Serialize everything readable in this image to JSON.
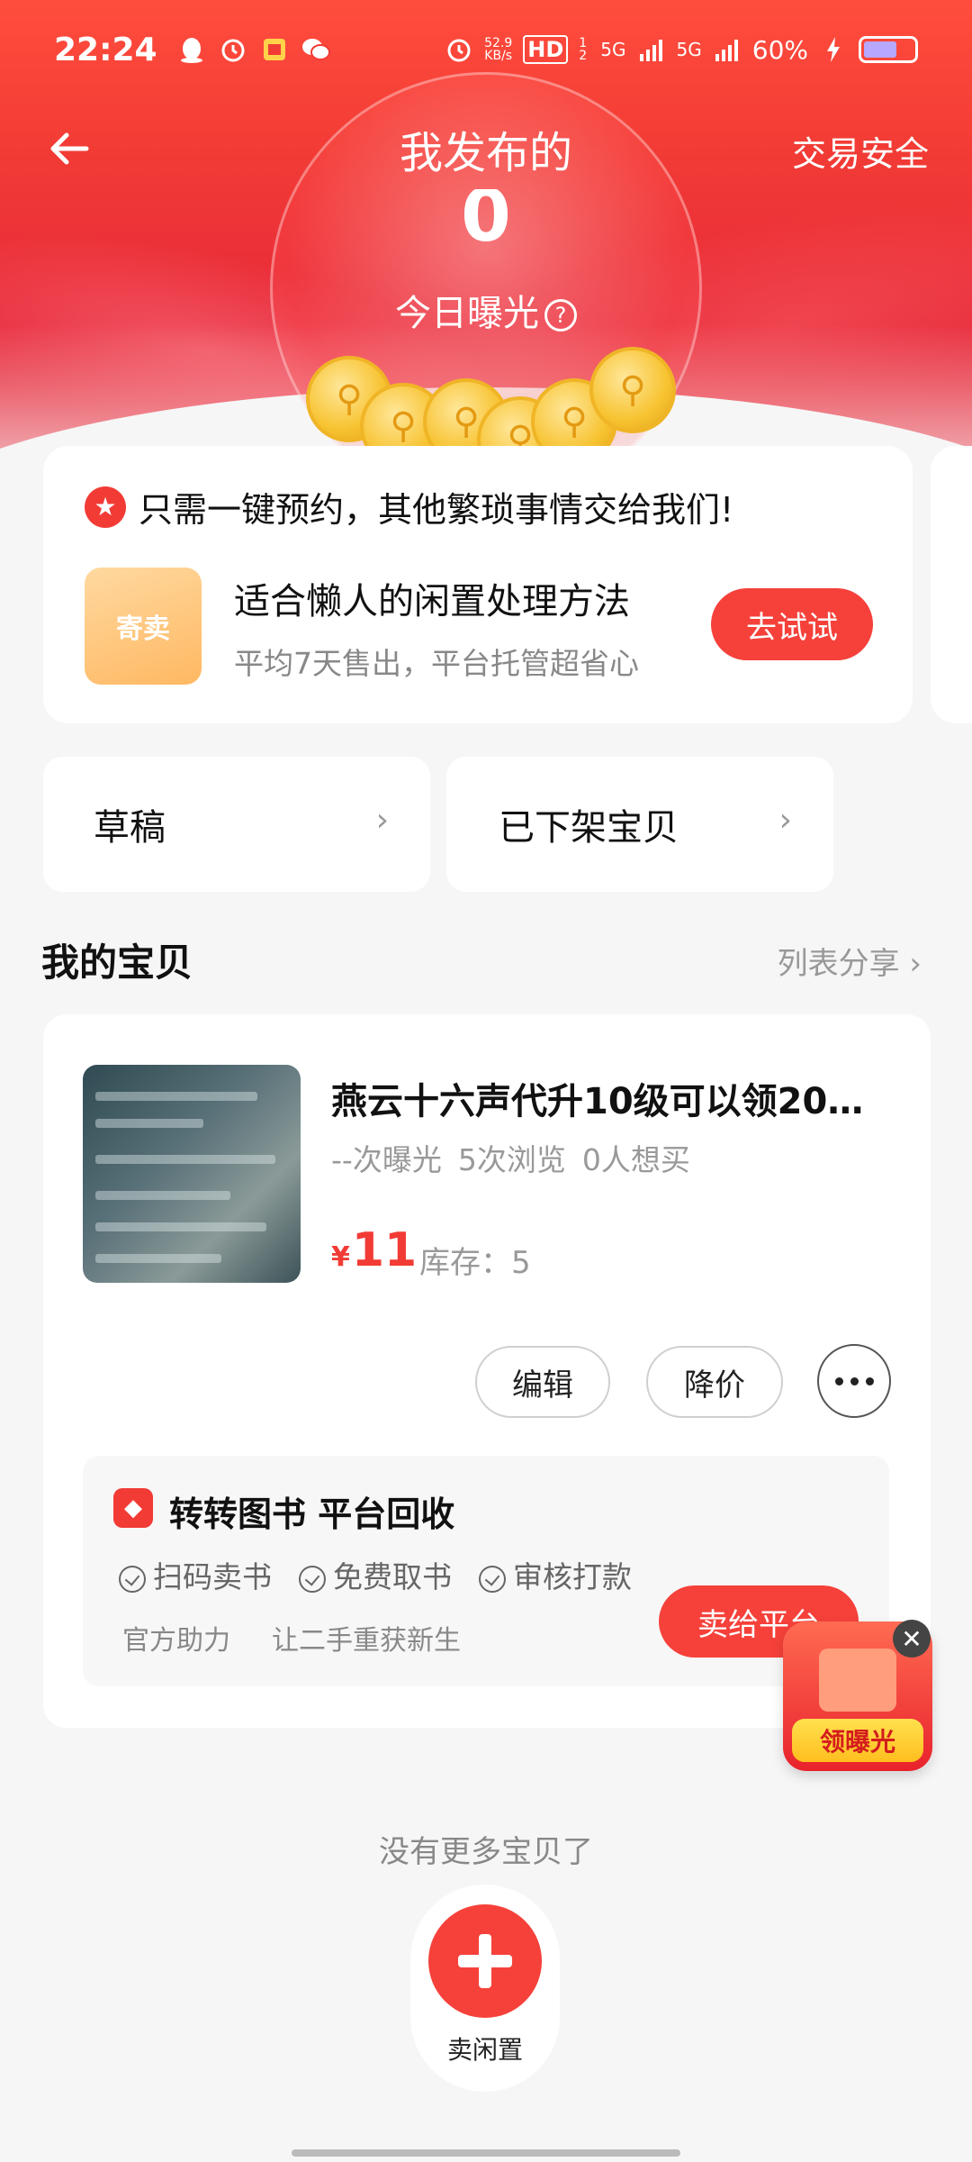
{
  "status_bar": {
    "time": "22:24",
    "net_speed": "52.9",
    "net_speed_unit": "KB/s",
    "hd": "HD",
    "hd_sub": "1 2",
    "sig1": "5G",
    "sig2": "5G",
    "battery": "60%"
  },
  "nav": {
    "title": "我发布的",
    "right_link": "交易安全"
  },
  "hero": {
    "exposure_value": "0",
    "exposure_label": "今日曝光",
    "help_icon": "?"
  },
  "promo": {
    "headline": "只需一键预约，其他繁琐事情交给我们!",
    "badge": "寄卖",
    "title": "适合懒人的闲置处理方法",
    "subtitle": "平均7天售出，平台托管超省心",
    "button": "去试试"
  },
  "quick_links": [
    {
      "label": "草稿"
    },
    {
      "label": "已下架宝贝"
    }
  ],
  "section": {
    "title": "我的宝贝",
    "share": "列表分享"
  },
  "item": {
    "title": "燕云十六声代升10级可以领20红...",
    "stats": [
      "--次曝光",
      "5次浏览",
      "0人想买"
    ],
    "currency": "¥",
    "price": "11",
    "stock": "库存：5",
    "actions": {
      "edit": "编辑",
      "reduce": "降价"
    }
  },
  "recycle": {
    "name": "转转图书 平台回收",
    "features": [
      "扫码卖书",
      "免费取书",
      "审核打款"
    ],
    "tags": [
      "官方助力",
      "让二手重获新生"
    ],
    "button": "卖给平台"
  },
  "float_ad": {
    "label": "领曝光"
  },
  "footer": {
    "no_more": "没有更多宝贝了",
    "fab_label": "卖闲置"
  }
}
